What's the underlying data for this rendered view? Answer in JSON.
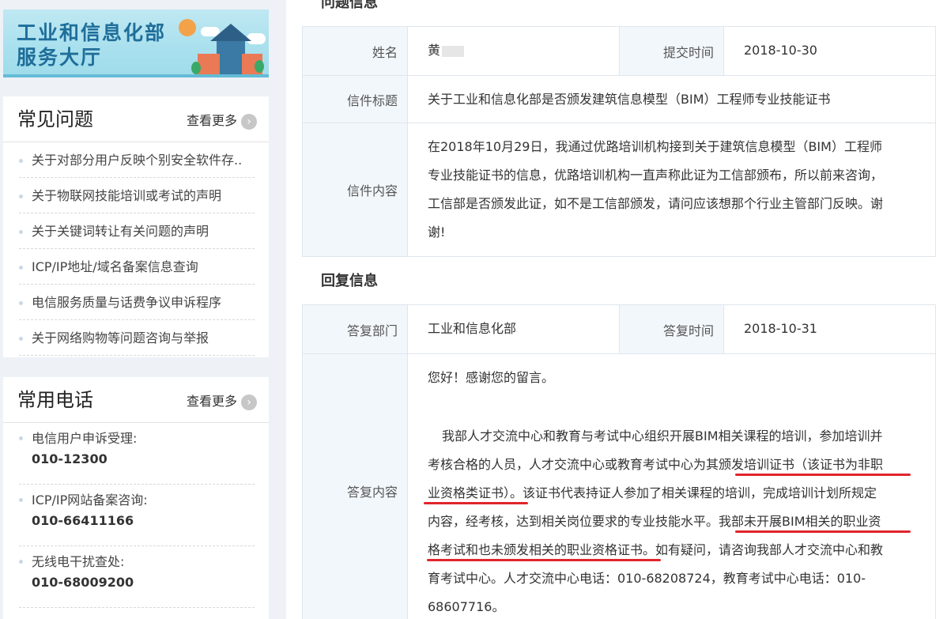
{
  "sidebar": {
    "banner_title_1": "工业和信息化部",
    "banner_title_2": "服务大厅",
    "faq": {
      "title": "常见问题",
      "more": "查看更多",
      "items": [
        "关于对部分用户反映个别安全软件存..",
        "关于物联网技能培训或考试的声明",
        "关于关键词转让有关问题的声明",
        "ICP/IP地址/域名备案信息查询",
        "电信服务质量与话费争议申诉程序",
        "关于网络购物等问题咨询与举报"
      ]
    },
    "phones": {
      "title": "常用电话",
      "more": "查看更多",
      "items": [
        {
          "label": "电信用户申诉受理:",
          "number": "010-12300"
        },
        {
          "label": "ICP/IP网站备案咨询:",
          "number": "010-66411166"
        },
        {
          "label": "无线电干扰查处:",
          "number": "010-68009200"
        }
      ]
    }
  },
  "question": {
    "section_title": "问题信息",
    "name_label": "姓名",
    "name_value": "黄",
    "submit_time_label": "提交时间",
    "submit_time_value": "2018-10-30",
    "subject_label": "信件标题",
    "subject_value": "关于工业和信息化部是否颁发建筑信息模型（BIM）工程师专业技能证书",
    "content_label": "信件内容",
    "content_lines": [
      "在2018年10月29日，我通过优路培训机构接到关于建筑信息模型（BIM）工程师",
      "专业技能证书的信息，优路培训机构一直声称此证为工信部颁布，所以前来咨询，",
      "工信部是否颁发此证，如不是工信部颁发，请问应该想那个行业主管部门反映。谢",
      "谢!"
    ]
  },
  "reply": {
    "section_title": "回复信息",
    "dept_label": "答复部门",
    "dept_value": "工业和信息化部",
    "time_label": "答复时间",
    "time_value": "2018-10-31",
    "content_label": "答复内容",
    "content_lines": [
      "您好！感谢您的留言。",
      "我部人才交流中心和教育与考试中心组织开展BIM相关课程的培训，参加培训并",
      "考核合格的人员，人才交流中心或教育考试中心为其颁发培训证书（该证书为非职",
      "业资格类证书）。该证书代表持证人参加了相关课程的培训，完成培训计划所规定",
      "内容，经考核，达到相关岗位要求的专业技能水平。我部未开展BIM相关的职业资",
      "格考试和也未颁发相关的职业资格证书。如有疑问，请咨询我部人才交流中心和教",
      "育考试中心。人才交流中心电话：010-68208724，教育考试中心电话：010-",
      "68607716。"
    ]
  },
  "colors": {
    "accent_underline": "#e0252c",
    "label_bg": "#f2f7fb",
    "banner_text": "#1f6e9a"
  }
}
